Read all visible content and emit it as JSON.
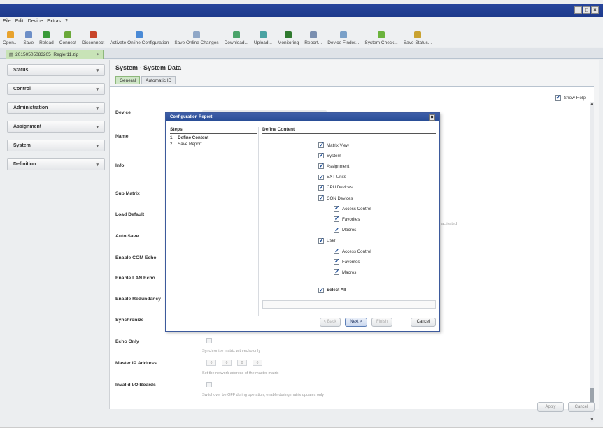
{
  "menubar": [
    "Eile",
    "Edit",
    "Device",
    "Extras",
    "?"
  ],
  "toolbar": [
    {
      "label": "Open...",
      "icon": "folder-icon",
      "color": "#e8a32d"
    },
    {
      "label": "Save",
      "icon": "save-icon",
      "color": "#6d8fc7"
    },
    {
      "label": "Reload",
      "icon": "reload-icon",
      "color": "#3a9b3a"
    },
    {
      "label": "Connect",
      "icon": "connect-icon",
      "color": "#6aa83a"
    },
    {
      "label": "Disconnect",
      "icon": "disconnect-icon",
      "color": "#c8452a"
    },
    {
      "label": "Activate Online Configuration",
      "icon": "activate-icon",
      "color": "#4a8ad6"
    },
    {
      "label": "Save Online Changes",
      "icon": "save-online-icon",
      "color": "#8fa7c7"
    },
    {
      "label": "Download...",
      "icon": "download-icon",
      "color": "#4aa36a"
    },
    {
      "label": "Upload...",
      "icon": "upload-icon",
      "color": "#4aa3a3"
    },
    {
      "label": "Monitoring",
      "icon": "monitoring-icon",
      "color": "#2f7a2f"
    },
    {
      "label": "Report...",
      "icon": "report-icon",
      "color": "#7a8fb0"
    },
    {
      "label": "Device Finder...",
      "icon": "device-finder-icon",
      "color": "#7aa0c8"
    },
    {
      "label": "System Check...",
      "icon": "system-check-icon",
      "color": "#6bb33d"
    },
    {
      "label": "Save Status...",
      "icon": "save-status-icon",
      "color": "#c9a231"
    }
  ],
  "doc_tab": {
    "label": "20150505083205_Regler11.zip"
  },
  "sidebar": [
    "Status",
    "Control",
    "Administration",
    "Assignment",
    "System",
    "Definition"
  ],
  "panel": {
    "title": "System - System Data",
    "tabs": [
      "General",
      "Automatic ID"
    ],
    "show_help": "Show Help",
    "fields": {
      "device": "Device",
      "name": "Name",
      "info": "Info",
      "sub_matrix": "Sub Matrix",
      "load_default": "Load Default",
      "auto_save": "Auto Save",
      "enable_com_echo": "Enable COM Echo",
      "enable_lan_echo": "Enable LAN Echo",
      "enable_redundancy": "Enable Redundancy",
      "synchronize": "Synchronize",
      "echo_only": "Echo Only",
      "echo_only_desc": "Synchronize matrix with echo only",
      "master_ip": "Master IP Address",
      "master_ip_desc": "Set the network address of the master matrix",
      "invalid_io": "Invalid I/O Boards",
      "invalid_io_desc": "Switchover be OFF during operation, enable during matrix updates only",
      "activated_note": "activated"
    },
    "ip_octets": [
      "0",
      "0",
      "0",
      "0"
    ],
    "buttons": {
      "apply": "Apply",
      "cancel": "Cancel"
    }
  },
  "dialog": {
    "title": "Configuration Report",
    "steps_header": "Steps",
    "steps": [
      {
        "num": "1.",
        "label": "Define Content"
      },
      {
        "num": "2.",
        "label": "Save Report"
      }
    ],
    "content_header": "Define Content",
    "items": [
      {
        "label": "Matrix View",
        "level": 0
      },
      {
        "label": "System",
        "level": 0
      },
      {
        "label": "Assignment",
        "level": 0
      },
      {
        "label": "EXT Units",
        "level": 0
      },
      {
        "label": "CPU Devices",
        "level": 0
      },
      {
        "label": "CON Devices",
        "level": 0
      },
      {
        "label": "Access Control",
        "level": 1
      },
      {
        "label": "Favorites",
        "level": 1
      },
      {
        "label": "Macros",
        "level": 1
      },
      {
        "label": "User",
        "level": 0
      },
      {
        "label": "Access Control",
        "level": 1
      },
      {
        "label": "Favorites",
        "level": 1
      },
      {
        "label": "Macros",
        "level": 1
      }
    ],
    "select_all": "Select All",
    "buttons": {
      "back": "< Back",
      "next": "Next >",
      "finish": "Finish",
      "cancel": "Cancel"
    }
  }
}
